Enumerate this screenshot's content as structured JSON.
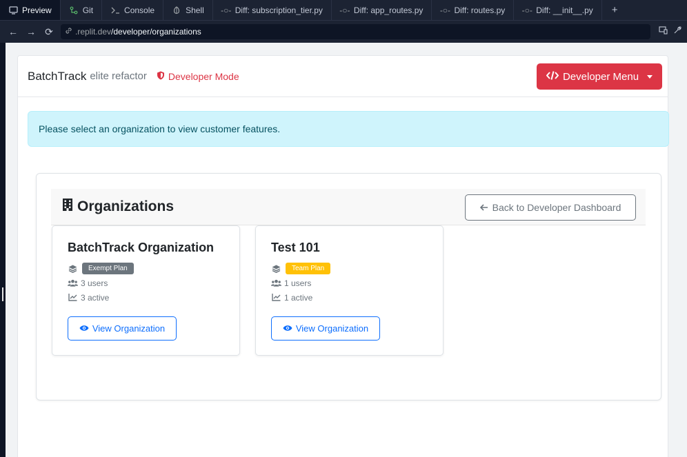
{
  "tabs": [
    {
      "label": "Preview",
      "icon": "monitor-icon",
      "active": true
    },
    {
      "label": "Git",
      "icon": "git-icon"
    },
    {
      "label": "Console",
      "icon": "terminal-icon"
    },
    {
      "label": "Shell",
      "icon": "shell-icon"
    },
    {
      "label": "Diff: subscription_tier.py",
      "icon": "diff-icon"
    },
    {
      "label": "Diff: app_routes.py",
      "icon": "diff-icon"
    },
    {
      "label": "Diff: routes.py",
      "icon": "diff-icon"
    },
    {
      "label": "Diff: __init__.py",
      "icon": "diff-icon"
    },
    {
      "label": "+",
      "icon": "plus-icon"
    }
  ],
  "url": {
    "host": ".replit.dev",
    "path": "/developer/organizations"
  },
  "navbar": {
    "brand": "BatchTrack",
    "brand_sub": "elite refactor",
    "dev_mode": "Developer Mode",
    "dev_menu": "Developer Menu"
  },
  "alert": {
    "text": "Please select an organization to view customer features."
  },
  "orgs_panel": {
    "title": "Organizations",
    "back_button": "Back to Developer Dashboard"
  },
  "organizations": [
    {
      "name": "BatchTrack Organization",
      "plan": "Exempt Plan",
      "users": "3 users",
      "active": "3 active",
      "view": "View Organization"
    },
    {
      "name": "Test 101",
      "plan": "Team Plan",
      "users": "1 users",
      "active": "1 active",
      "view": "View Organization"
    }
  ],
  "colors": {
    "danger": "#dc3545",
    "primary": "#0d6efd",
    "info_bg": "#cff4fc",
    "exempt_badge": "#6c757d",
    "team_badge": "#ffc107"
  }
}
